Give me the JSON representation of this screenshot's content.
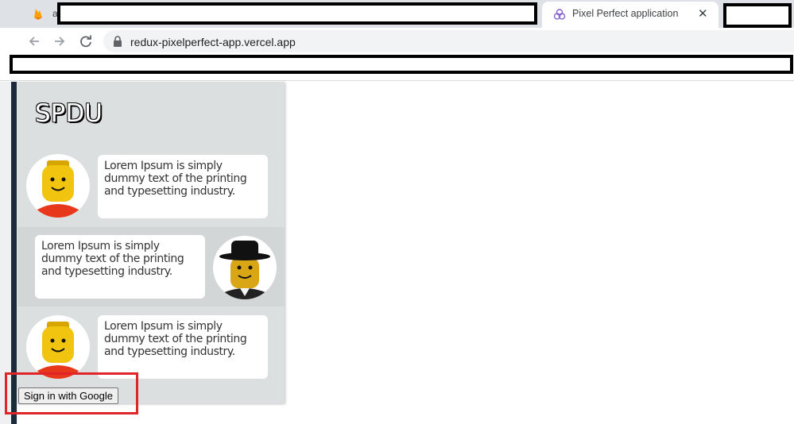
{
  "browser": {
    "tabs": [
      {
        "label": "a",
        "active": false,
        "icon": "firebase-icon"
      },
      {
        "label": "Pixel Perfect application",
        "active": true,
        "icon": "app-icon"
      }
    ],
    "url": "redux-pixelperfect-app.vercel.app"
  },
  "app": {
    "brand": "SPDU",
    "messages": [
      {
        "text": "Lorem Ipsum is simply dummy text of the printing and typesetting industry.",
        "avatar": "lego-yellow-head-red-shirt",
        "side": "left"
      },
      {
        "text": "Lorem Ipsum is simply dummy text of the printing and typesetting industry.",
        "avatar": "lego-head-black-hat",
        "side": "right"
      },
      {
        "text": "Lorem Ipsum is simply dummy text of the printing and typesetting industry.",
        "avatar": "lego-yellow-head-red-shirt",
        "side": "left"
      }
    ],
    "signin_label": "Sign in with Google"
  },
  "colors": {
    "panel": "#dcdfe0",
    "highlight": "#e0242a",
    "stripe": "#1c2b3c"
  }
}
